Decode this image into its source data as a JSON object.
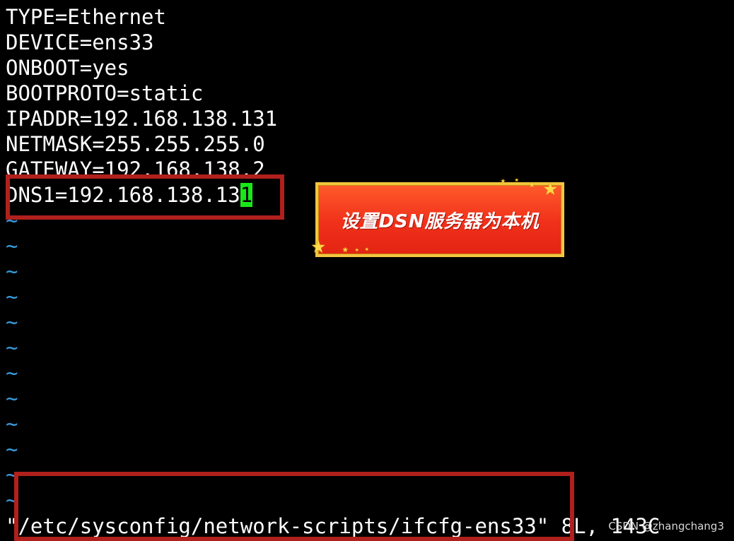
{
  "editor": {
    "lines": [
      "TYPE=Ethernet",
      "DEVICE=ens33",
      "ONBOOT=yes",
      "BOOTPROTO=static",
      "IPADDR=192.168.138.131",
      "NETMASK=255.255.255.0",
      "GATEWAY=192.168.138.2"
    ],
    "dns_line_before_cursor": "DNS1=192.168.138.13",
    "cursor_char": "1",
    "tilde": "~",
    "status": {
      "filename": "\"/etc/sysconfig/network-scripts/ifcfg-ens33\"",
      "info": " 8L, 143C"
    }
  },
  "annotation": {
    "text": "设置DSN服务器为本机",
    "star_glyph": "★"
  },
  "watermark": "CSDN @zhangchang3",
  "colors": {
    "background": "#000000",
    "text": "#ffffff",
    "tilde": "#3a9bdc",
    "cursor": "#18e818",
    "highlight_box": "#b0201c",
    "banner_fill": "#f0301a",
    "banner_border": "#f2c640"
  }
}
